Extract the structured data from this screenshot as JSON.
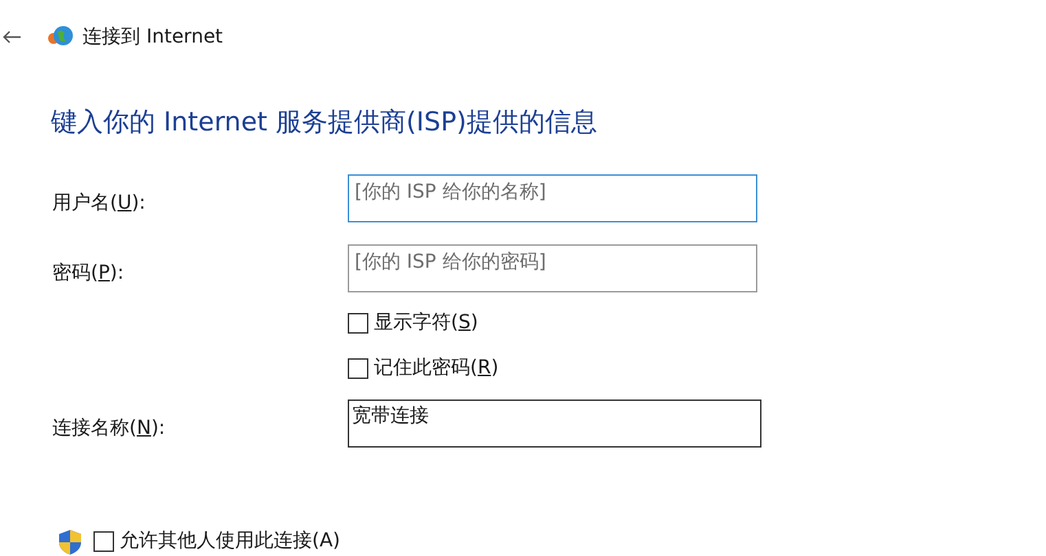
{
  "window": {
    "title": "连接到 Internet"
  },
  "heading": "键入你的 Internet 服务提供商(ISP)提供的信息",
  "fields": [
    {
      "label_before": "用户名(",
      "access_key": "U",
      "label_after": "):",
      "placeholder": "[你的 ISP 给你的名称]",
      "focused": true
    },
    {
      "label_before": "密码(",
      "access_key": "P",
      "label_after": "):",
      "placeholder": "[你的 ISP 给你的密码]",
      "focused": false
    }
  ],
  "options": [
    {
      "label_before": "显示字符(",
      "access_key": "S",
      "label_after": ")",
      "checked": false
    },
    {
      "label_before": "记住此密码(",
      "access_key": "R",
      "label_after": ")",
      "checked": false
    }
  ],
  "connection_name": {
    "label_before": "连接名称(",
    "access_key": "N",
    "label_after": "):",
    "value": "宽带连接",
    "focused": false
  },
  "share": {
    "label": "允许其他人使用此连接(A)",
    "checked": false
  }
}
